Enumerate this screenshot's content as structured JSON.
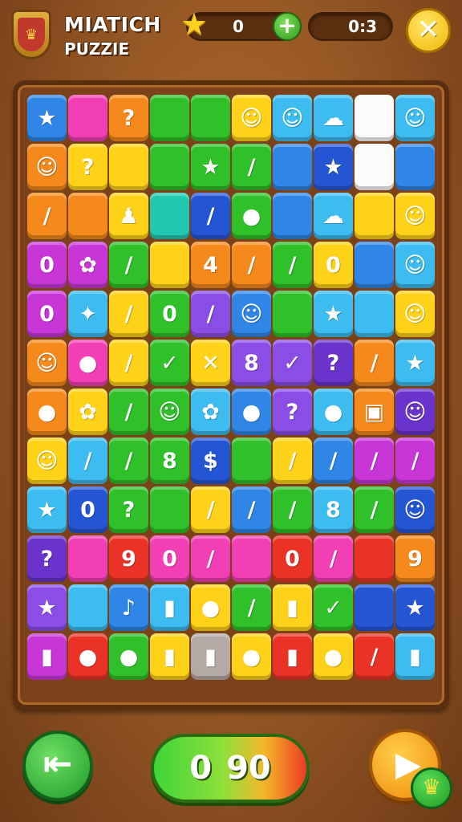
{
  "header": {
    "title_line1": "MIATICH",
    "title_line2": "PUZZIE",
    "star_count": "0",
    "timer": "0:3",
    "icons": {
      "logo": "shield-emblem-icon",
      "star": "star-icon",
      "plus": "plus-icon",
      "close": "close-icon"
    },
    "glyphs": {
      "star": "★",
      "plus": "+",
      "close": "✕",
      "shield": "♛"
    }
  },
  "board": {
    "columns": 10,
    "rows": [
      [
        [
          "blue",
          "★"
        ],
        [
          "pink",
          ""
        ],
        [
          "orange",
          "?"
        ],
        [
          "green",
          ""
        ],
        [
          "green",
          ""
        ],
        [
          "yellow",
          "☺"
        ],
        [
          "lblue",
          "☺"
        ],
        [
          "lblue",
          "☁"
        ],
        [
          "white",
          ""
        ],
        [
          "lblue",
          "☺"
        ]
      ],
      [
        [
          "orange",
          "☺"
        ],
        [
          "yellow",
          "?"
        ],
        [
          "yellow",
          ""
        ],
        [
          "green",
          ""
        ],
        [
          "green",
          "★"
        ],
        [
          "green",
          "/"
        ],
        [
          "blue",
          ""
        ],
        [
          "dblue",
          "★"
        ],
        [
          "white",
          ""
        ],
        [
          "blue",
          ""
        ]
      ],
      [
        [
          "orange",
          "/"
        ],
        [
          "orange",
          ""
        ],
        [
          "yellow",
          "♟"
        ],
        [
          "teal",
          ""
        ],
        [
          "dblue",
          "/"
        ],
        [
          "green",
          "●"
        ],
        [
          "blue",
          ""
        ],
        [
          "lblue",
          "☁"
        ],
        [
          "yellow",
          ""
        ],
        [
          "yellow",
          "☺"
        ]
      ],
      [
        [
          "magenta",
          "0"
        ],
        [
          "magenta",
          "✿"
        ],
        [
          "green",
          "/"
        ],
        [
          "yellow",
          ""
        ],
        [
          "orange",
          "4"
        ],
        [
          "orange",
          "/"
        ],
        [
          "green",
          "/"
        ],
        [
          "yellow",
          "0"
        ],
        [
          "blue",
          ""
        ],
        [
          "lblue",
          "☺"
        ]
      ],
      [
        [
          "magenta",
          "0"
        ],
        [
          "lblue",
          "✦"
        ],
        [
          "yellow",
          "/"
        ],
        [
          "green",
          "0"
        ],
        [
          "purple",
          "/"
        ],
        [
          "blue",
          "☺"
        ],
        [
          "green",
          ""
        ],
        [
          "lblue",
          "★"
        ],
        [
          "lblue",
          ""
        ],
        [
          "yellow",
          "☺"
        ]
      ],
      [
        [
          "orange",
          "☺"
        ],
        [
          "pink",
          "●"
        ],
        [
          "yellow",
          "/"
        ],
        [
          "green",
          "✓"
        ],
        [
          "yellow",
          "✕"
        ],
        [
          "purple",
          "8"
        ],
        [
          "purple",
          "✓"
        ],
        [
          "dpurple",
          "?"
        ],
        [
          "orange",
          "/"
        ],
        [
          "lblue",
          "★"
        ]
      ],
      [
        [
          "orange",
          "●"
        ],
        [
          "yellow",
          "✿"
        ],
        [
          "green",
          "/"
        ],
        [
          "green",
          "☺"
        ],
        [
          "lblue",
          "✿"
        ],
        [
          "blue",
          "●"
        ],
        [
          "purple",
          "?"
        ],
        [
          "lblue",
          "●"
        ],
        [
          "orange",
          "▣"
        ],
        [
          "dpurple",
          "☺"
        ]
      ],
      [
        [
          "yellow",
          "☺"
        ],
        [
          "lblue",
          "/"
        ],
        [
          "green",
          "/"
        ],
        [
          "green",
          "8"
        ],
        [
          "dblue",
          "$"
        ],
        [
          "green",
          ""
        ],
        [
          "yellow",
          "/"
        ],
        [
          "blue",
          "/"
        ],
        [
          "magenta",
          "/"
        ],
        [
          "magenta",
          "/"
        ]
      ],
      [
        [
          "lblue",
          "★"
        ],
        [
          "dblue",
          "0"
        ],
        [
          "green",
          "?"
        ],
        [
          "green",
          ""
        ],
        [
          "yellow",
          "/"
        ],
        [
          "blue",
          "/"
        ],
        [
          "green",
          "/"
        ],
        [
          "lblue",
          "8"
        ],
        [
          "green",
          "/"
        ],
        [
          "dblue",
          "☺"
        ]
      ],
      [
        [
          "dpurple",
          "?"
        ],
        [
          "pink",
          ""
        ],
        [
          "red",
          "9"
        ],
        [
          "pink",
          "0"
        ],
        [
          "pink",
          "/"
        ],
        [
          "pink",
          ""
        ],
        [
          "red",
          "0"
        ],
        [
          "pink",
          "/"
        ],
        [
          "red",
          ""
        ],
        [
          "orange",
          "9"
        ]
      ],
      [
        [
          "purple",
          "★"
        ],
        [
          "lblue",
          ""
        ],
        [
          "blue",
          "♪"
        ],
        [
          "lblue",
          "▮"
        ],
        [
          "yellow",
          "●"
        ],
        [
          "green",
          "/"
        ],
        [
          "yellow",
          "▮"
        ],
        [
          "green",
          "✓"
        ],
        [
          "dblue",
          ""
        ],
        [
          "dblue",
          "★"
        ]
      ],
      [
        [
          "magenta",
          "▮"
        ],
        [
          "red",
          "●"
        ],
        [
          "green",
          "●"
        ],
        [
          "yellow",
          "▮"
        ],
        [
          "gray",
          "▮"
        ],
        [
          "yellow",
          "●"
        ],
        [
          "red",
          "▮"
        ],
        [
          "yellow",
          "●"
        ],
        [
          "red",
          "/"
        ],
        [
          "lblue",
          "▮"
        ]
      ]
    ]
  },
  "footer": {
    "score_left": "0",
    "score_right": "90",
    "icons": {
      "back": "exit-arrow-icon",
      "play": "play-icon",
      "bonus": "bonus-badge-icon"
    },
    "glyphs": {
      "back": "⇤",
      "play": "▶",
      "bonus": "♛"
    }
  }
}
